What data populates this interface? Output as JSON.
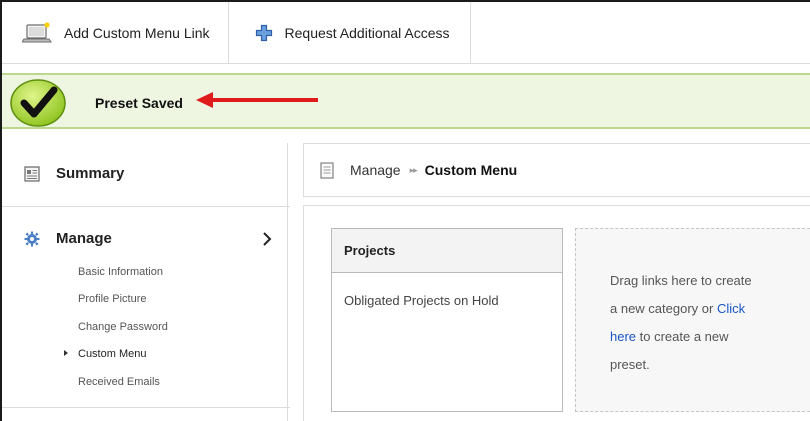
{
  "toolbar": {
    "add_custom_menu_link": "Add Custom Menu Link",
    "request_additional_access": "Request Additional Access"
  },
  "status": {
    "message": "Preset Saved",
    "color": "#eef5e1",
    "accent": "#9bd02a",
    "arrow_color": "#e01b1b"
  },
  "sidebar": {
    "summary": "Summary",
    "manage": "Manage",
    "items": [
      {
        "label": "Basic Information"
      },
      {
        "label": "Profile Picture"
      },
      {
        "label": "Change Password"
      },
      {
        "label": "Custom Menu",
        "active": true
      },
      {
        "label": "Received Emails"
      }
    ]
  },
  "breadcrumb": {
    "parent": "Manage",
    "separator": "▸▸",
    "current": "Custom Menu"
  },
  "projects": {
    "header": "Projects",
    "items": [
      "Obligated Projects on Hold"
    ]
  },
  "dropzone": {
    "line1": "Drag links here to create",
    "line2_prefix": "a new category or ",
    "link_text_1": "Click",
    "link_text_2": "here",
    "line3_suffix": " to create a new",
    "line4": "preset."
  }
}
